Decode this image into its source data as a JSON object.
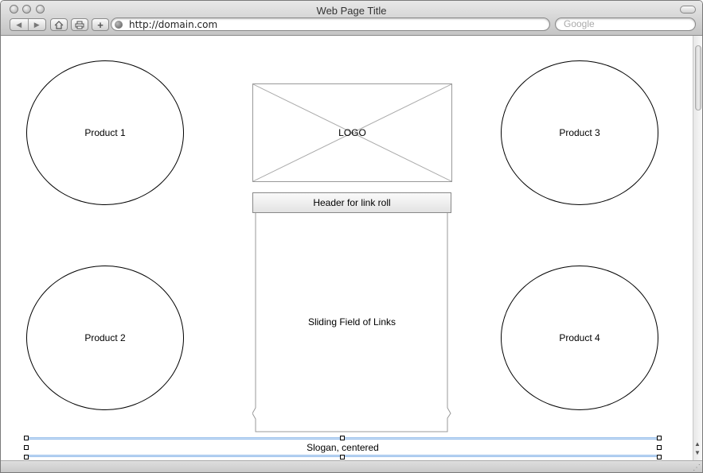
{
  "window": {
    "title": "Web Page Title"
  },
  "toolbar": {
    "url": "http://domain.com",
    "search_placeholder": "Google"
  },
  "page": {
    "products": [
      {
        "label": "Product 1"
      },
      {
        "label": "Product 2"
      },
      {
        "label": "Product 3"
      },
      {
        "label": "Product 4"
      }
    ],
    "logo_label": "LOGO",
    "link_header": "Header for link roll",
    "link_field": "Sliding Field of Links",
    "slogan": "Slogan, centered"
  },
  "icons": [
    "back-arrow-icon",
    "forward-arrow-icon",
    "home-icon",
    "print-icon",
    "add-bookmark-icon",
    "globe-icon"
  ]
}
